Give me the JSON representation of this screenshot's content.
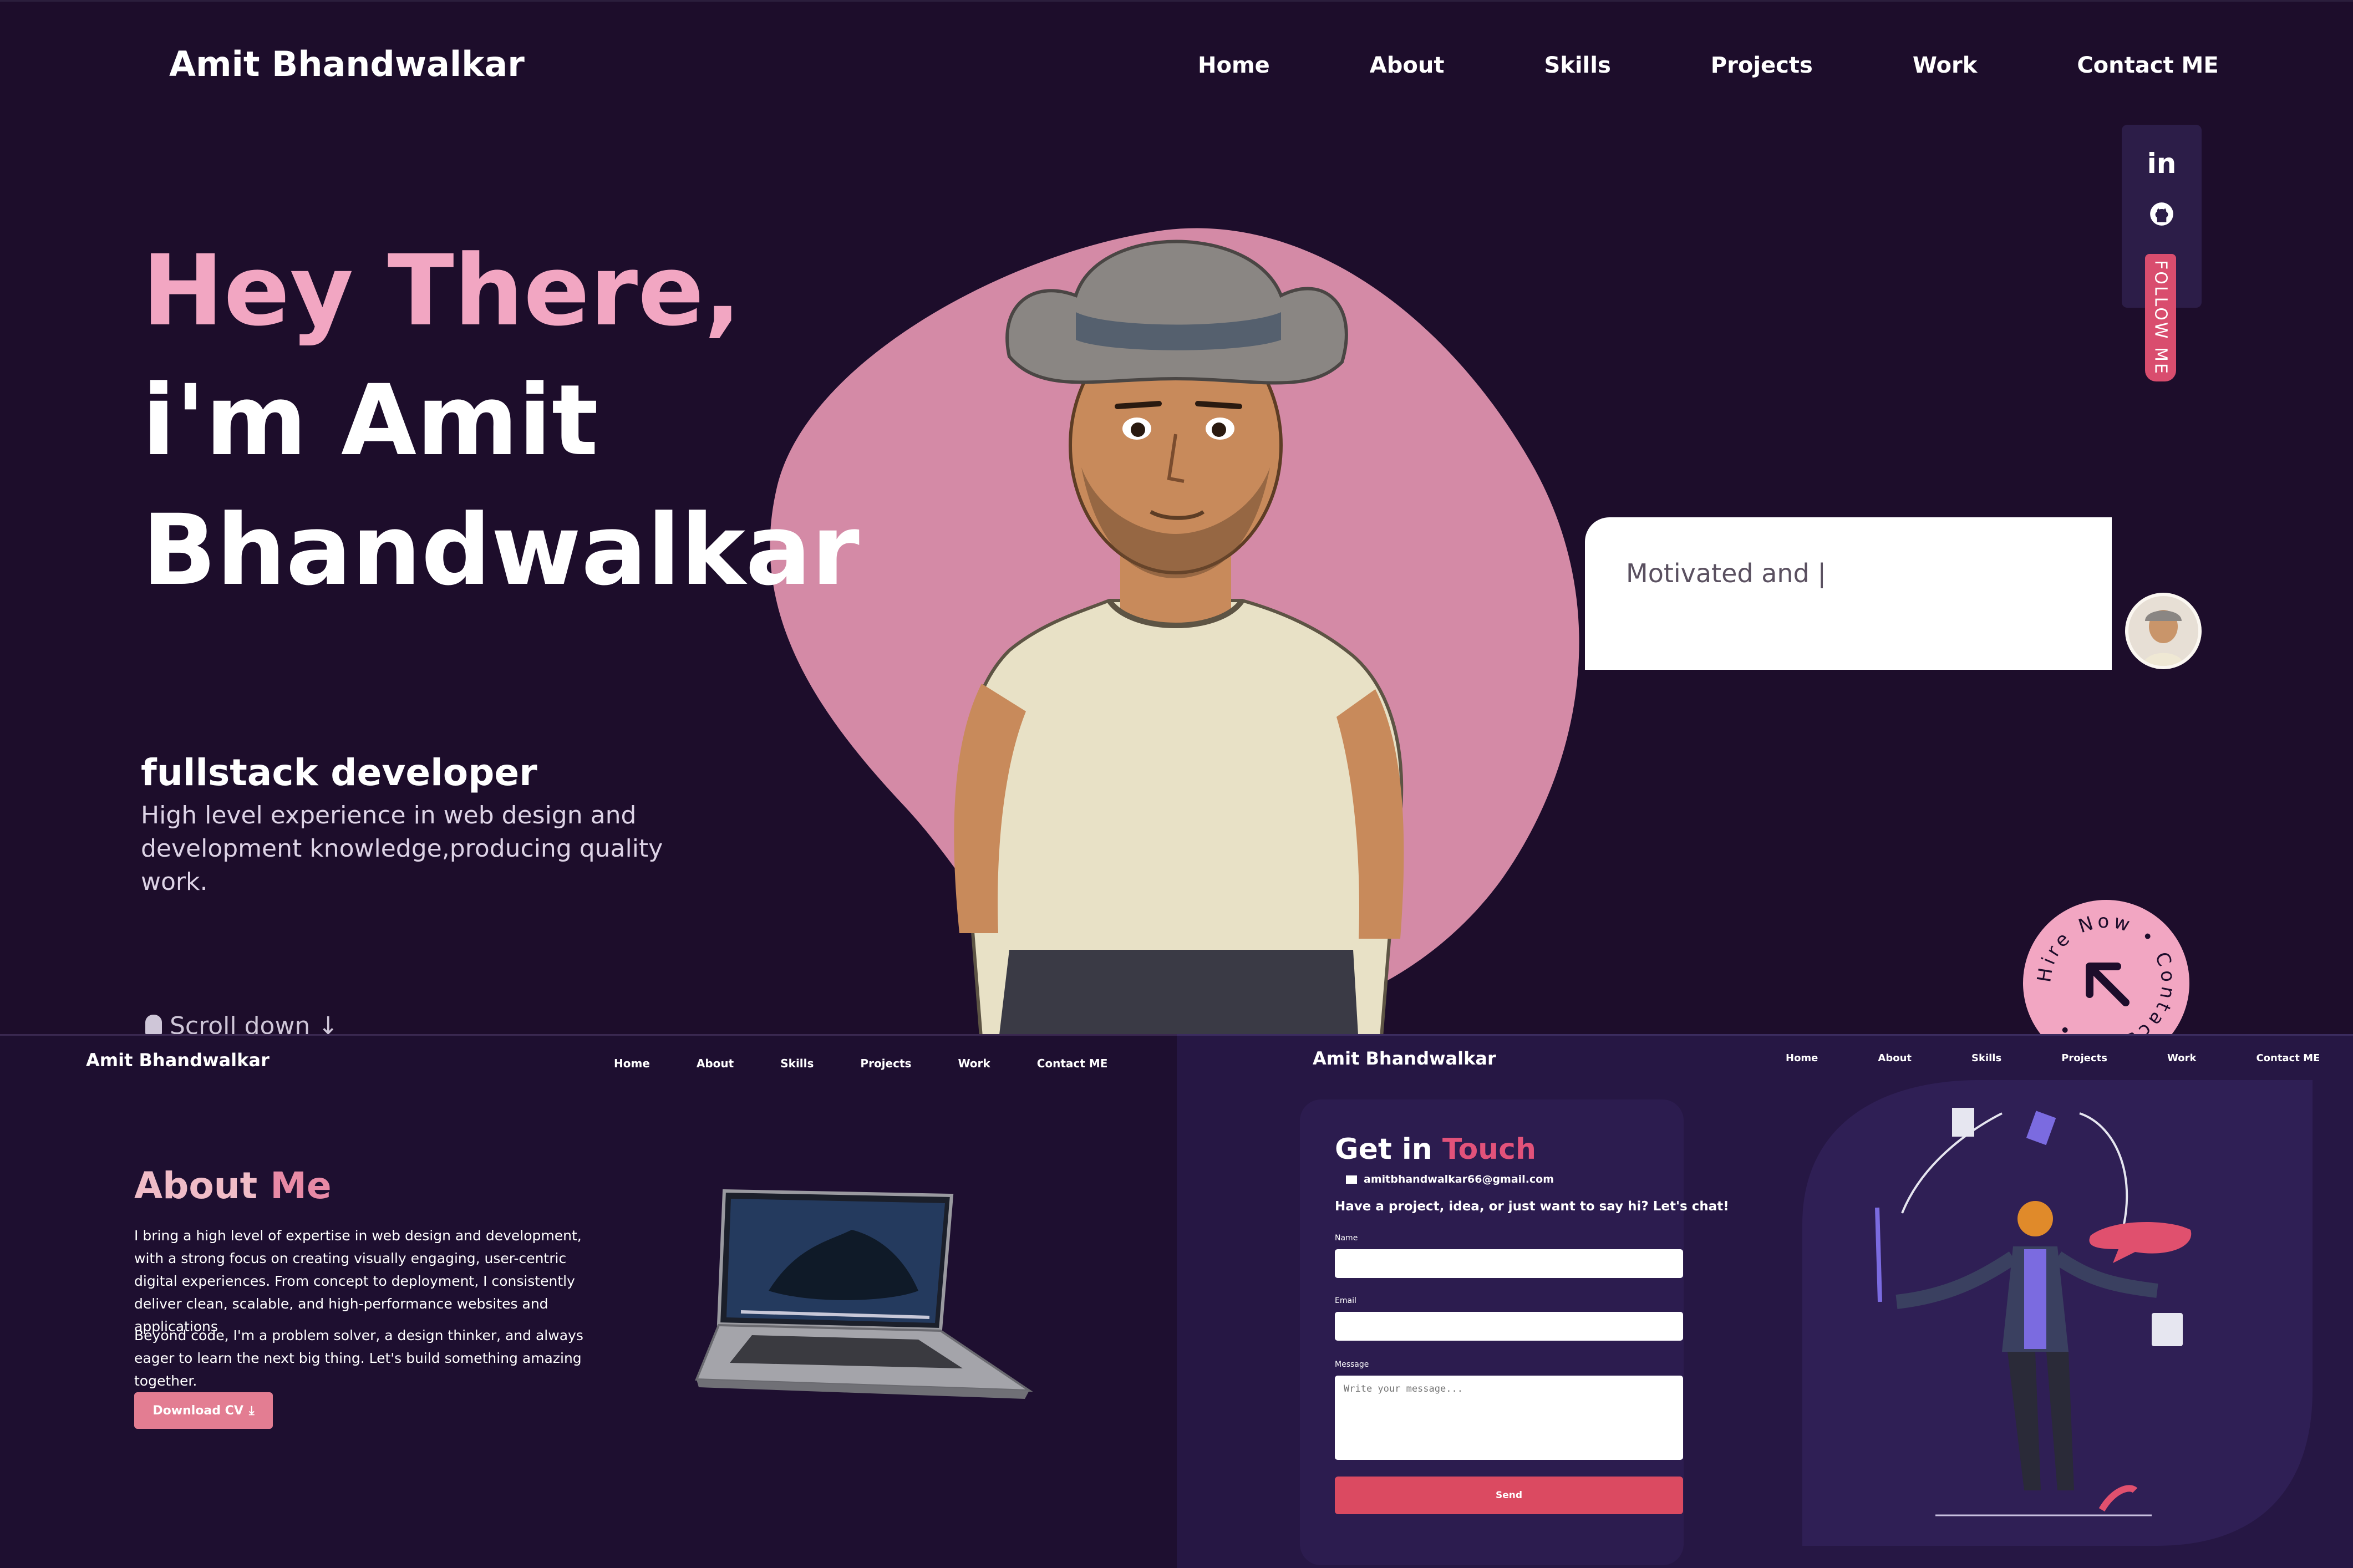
{
  "hero": {
    "brand": "Amit Bhandwalkar",
    "nav": [
      "Home",
      "About",
      "Skills",
      "Projects",
      "Work",
      "Contact ME"
    ],
    "title_line1": "Hey There,",
    "title_line2": "i'm Amit",
    "title_line3": "Bhandwalkar",
    "role": "fullstack developer",
    "role_desc": "High level experience in web design and development knowledge,producing quality work.",
    "scroll_label": "Scroll down",
    "social_icons": [
      "linkedin-icon",
      "github-icon"
    ],
    "follow_label": "FOLLOW ME",
    "typing_text": "Motivated and |",
    "hire_badge_text": "Hire Now • Contact Me •",
    "accent_pink": "#f2a6c2",
    "accent_red": "#d94d6e"
  },
  "about": {
    "brand": "Amit Bhandwalkar",
    "nav": [
      "Home",
      "About",
      "Skills",
      "Projects",
      "Work",
      "Contact ME"
    ],
    "title_white": "About",
    "title_pink": "Me",
    "paragraph1": "I bring a high level of expertise in web design and development, with a strong focus on creating visually engaging, user-centric digital experiences. From concept to deployment, I consistently deliver clean, scalable, and high-performance websites and applications",
    "paragraph2": "Beyond code, I'm a problem solver, a design thinker, and always eager to learn the next big thing. Let's build something amazing together.",
    "download_label": "Download CV"
  },
  "contact": {
    "brand": "Amit Bhandwalkar",
    "nav": [
      "Home",
      "About",
      "Skills",
      "Projects",
      "Work",
      "Contact ME"
    ],
    "title_white": "Get in",
    "title_pink": "Touch",
    "email": "amitbhandwalkar66@gmail.com",
    "pitch": "Have a project, idea, or just want to say hi? Let's chat!",
    "name_label": "Name",
    "email_label": "Email",
    "message_label": "Message",
    "message_placeholder": "Write your message...",
    "send_label": "Send"
  }
}
